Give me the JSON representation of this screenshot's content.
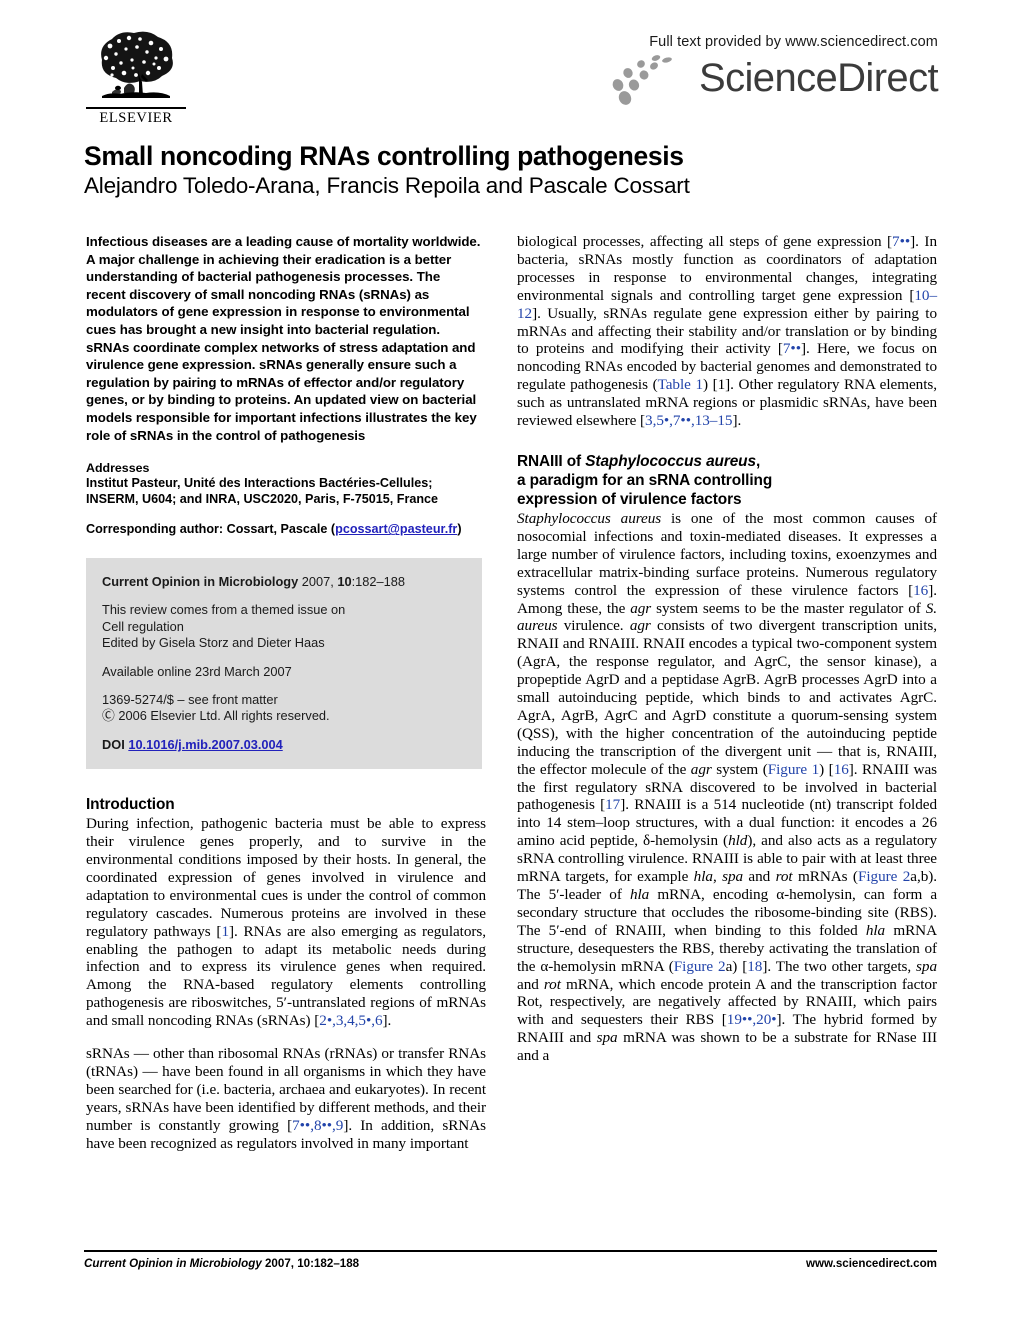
{
  "masthead": {
    "publisher": "ELSEVIER",
    "sciencedirect_tagline": "Full text provided by www.sciencedirect.com",
    "sciencedirect_name": "ScienceDirect"
  },
  "article": {
    "title": "Small noncoding RNAs controlling pathogenesis",
    "authors": "Alejandro Toledo-Arana, Francis Repoila and Pascale Cossart"
  },
  "abstract": {
    "text": "Infectious diseases are a leading cause of mortality worldwide. A major challenge in achieving their eradication is a better understanding of bacterial pathogenesis processes. The recent discovery of small noncoding RNAs (sRNAs) as modulators of gene expression in response to environmental cues has brought a new insight into bacterial regulation. sRNAs coordinate complex networks of stress adaptation and virulence gene expression. sRNAs generally ensure such a regulation by pairing to mRNAs of effector and/or regulatory genes, or by binding to proteins. An updated view on bacterial models responsible for important infections illustrates the key role of sRNAs in the control of pathogenesis"
  },
  "addresses": {
    "heading": "Addresses",
    "text": "Institut Pasteur, Unité des Interactions Bactéries-Cellules; INSERM, U604; and INRA, USC2020, Paris, F-75015, France",
    "corresponding_label": "Corresponding author: Cossart, Pascale (",
    "corresponding_email": "pcossart@pasteur.fr",
    "corresponding_close": ")"
  },
  "infobox": {
    "journal": "Current Opinion in Microbiology",
    "citation": " 2007, ",
    "volume": "10",
    "pages": ":182–188",
    "themed_line1": "This review comes from a themed issue on",
    "themed_line2": "Cell regulation",
    "themed_line3": "Edited by Gisela Storz and Dieter Haas",
    "available": "Available online 23rd March 2007",
    "front_matter": "1369-5274/$ – see front matter",
    "copyright": "Ⓒ 2006 Elsevier Ltd. All rights reserved.",
    "doi_label": "DOI",
    "doi_value": "10.1016/j.mib.2007.03.004"
  },
  "sections": {
    "introduction": {
      "heading": "Introduction",
      "paragraphs": [
        "During infection, pathogenic bacteria must be able to express their virulence genes properly, and to survive in the environmental conditions imposed by their hosts. In general, the coordinated expression of genes involved in virulence and adaptation to environmental cues is under the control of common regulatory cascades. Numerous proteins are involved in these regulatory pathways [1]. RNAs are also emerging as regulators, enabling the pathogen to adapt its metabolic needs during infection and to express its virulence genes when required. Among the RNA-based regulatory elements controlling pathogenesis are riboswitches, 5′-untranslated regions of mRNAs and small noncoding RNAs (sRNAs) [2•,3,4,5•,6].",
        "sRNAs — other than ribosomal RNAs (rRNAs) or transfer RNAs (tRNAs) — have been found in all organisms in which they have been searched for (i.e. bacteria, archaea and eukaryotes). In recent years, sRNAs have been identified by different methods, and their number is constantly growing [7••,8••,9]. In addition, sRNAs have been recognized as regulators involved in many important",
        "biological processes, affecting all steps of gene expression [7••]. In bacteria, sRNAs mostly function as coordinators of adaptation processes in response to environmental changes, integrating environmental signals and controlling target gene expression [10–12]. Usually, sRNAs regulate gene expression either by pairing to mRNAs and affecting their stability and/or translation or by binding to proteins and modifying their activity [7••]. Here, we focus on noncoding RNAs encoded by bacterial genomes and demonstrated to regulate pathogenesis (Table 1) [1]. Other regulatory RNA elements, such as untranslated mRNA regions or plasmidic sRNAs, have been reviewed elsewhere [3,5•,7••,13–15]."
      ]
    },
    "rnaiii": {
      "heading_line1_pre": "RNAIII of ",
      "heading_line1_italic": "Staphylococcus aureus",
      "heading_line1_post": ",",
      "heading_line2": "a paradigm for an sRNA controlling",
      "heading_line3": "expression of virulence factors",
      "paragraphs": [
        "Staphylococcus aureus is one of the most common causes of nosocomial infections and toxin-mediated diseases. It expresses a large number of virulence factors, including toxins, exoenzymes and extracellular matrix-binding surface proteins. Numerous regulatory systems control the expression of these virulence factors [16]. Among these, the agr system seems to be the master regulator of S. aureus virulence. agr consists of two divergent transcription units, RNAII and RNAIII. RNAII encodes a typical two-component system (AgrA, the response regulator, and AgrC, the sensor kinase), a propeptide AgrD and a peptidase AgrB. AgrB processes AgrD into a small autoinducing peptide, which binds to and activates AgrC. AgrA, AgrB, AgrC and AgrD constitute a quorum-sensing system (QSS), with the higher concentration of the autoinducing peptide inducing the transcription of the divergent unit — that is, RNAIII, the effector molecule of the agr system (Figure 1) [16]. RNAIII was the first regulatory sRNA discovered to be involved in bacterial pathogenesis [17]. RNAIII is a 514 nucleotide (nt) transcript folded into 14 stem–loop structures, with a dual function: it encodes a 26 amino acid peptide, δ-hemolysin (hld), and also acts as a regulatory sRNA controlling virulence. RNAIII is able to pair with at least three mRNA targets, for example hla, spa and rot mRNAs (Figure 2a,b). The 5′-leader of hla mRNA, encoding α-hemolysin, can form a secondary structure that occludes the ribosome-binding site (RBS). The 5′-end of RNAIII, when binding to this folded hla mRNA structure, desequesters the RBS, thereby activating the translation of the α-hemolysin mRNA (Figure 2a) [18]. The two other targets, spa and rot mRNA, which encode protein A and the transcription factor Rot, respectively, are negatively affected by RNAIII, which pairs with and sequesters their RBS [19••,20•]. The hybrid formed by RNAIII and spa mRNA was shown to be a substrate for RNase III and a"
      ]
    }
  },
  "footer": {
    "left_journal": "Current Opinion in Microbiology",
    "left_rest": " 2007, 10:182–188",
    "right": "www.sciencedirect.com"
  },
  "colors": {
    "link": "#2222bb",
    "reference": "#2244aa",
    "infobox_bg": "#dcdcdc",
    "sciencedirect_gray": "#3b3b3b"
  }
}
